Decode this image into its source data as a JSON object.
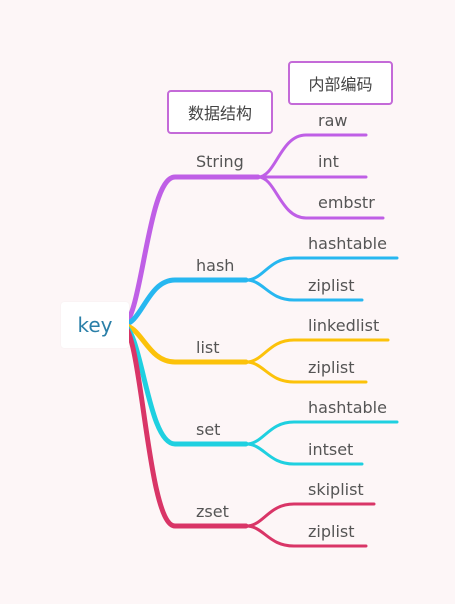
{
  "root": {
    "label": "key"
  },
  "headers": {
    "structure": "数据结构",
    "encoding": "内部编码"
  },
  "colors": {
    "root_text": "#2a7fa8",
    "tag_border": "#c46ad8",
    "string": "#bf5fe6",
    "hash": "#27b7f0",
    "list": "#fcc20a",
    "set": "#1fd0e0",
    "zset": "#d93567"
  },
  "branches": [
    {
      "label": "String",
      "color": "#bf5fe6",
      "children": [
        "raw",
        "int",
        "embstr"
      ]
    },
    {
      "label": "hash",
      "color": "#27b7f0",
      "children": [
        "hashtable",
        "ziplist"
      ]
    },
    {
      "label": "list",
      "color": "#fcc20a",
      "children": [
        "linkedlist",
        "ziplist"
      ]
    },
    {
      "label": "set",
      "color": "#1fd0e0",
      "children": [
        "hashtable",
        "intset"
      ]
    },
    {
      "label": "zset",
      "color": "#d93567",
      "children": [
        "skiplist",
        "ziplist"
      ]
    }
  ]
}
